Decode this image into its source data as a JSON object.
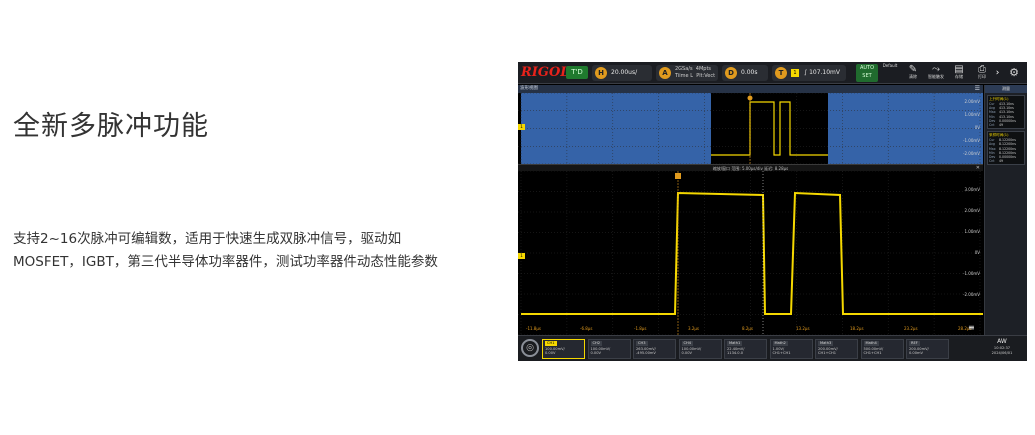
{
  "headline": "全新多脉冲功能",
  "description": "支持2~16次脉冲可编辑数，适用于快速生成双脉冲信号，驱动如MOSFET，IGBT，第三代半导体功率器件，测试功率器件动态性能参数",
  "scope": {
    "brand": "RIGOL",
    "run_state": "T'D",
    "horizontal": {
      "badge": "H",
      "value": "20.00us/",
      "sub1": "",
      "sub2": ""
    },
    "acquire": {
      "badge": "A",
      "line1": "2GSa/s",
      "line2": "Tiime L",
      "right1": "4Mpts",
      "right2": "Plt:Vect"
    },
    "delay": {
      "badge": "D",
      "value": "0.00s"
    },
    "trigger": {
      "badge": "T",
      "source": "1",
      "edge": "∫",
      "value": "107.10mV"
    },
    "tools": [
      {
        "name": "auto",
        "icon": "",
        "label": "AUTO\nSET"
      },
      {
        "name": "default",
        "icon": "",
        "label": "Default"
      },
      {
        "name": "clear",
        "icon": "✎",
        "label": "清除"
      },
      {
        "name": "single",
        "icon": "⤳",
        "label": "智能触发"
      },
      {
        "name": "storage",
        "icon": "▤",
        "label": "存储"
      },
      {
        "name": "quick",
        "icon": "⎙",
        "label": "打印"
      }
    ],
    "overview_title": "波形视图",
    "zoom_title": "缩放/窗口  范围: 5.00μs/div  延迟: 8.28μs",
    "channel_marker": "1",
    "overview_axis": [
      "2.00mV",
      "1.00mV",
      "0V",
      "-1.00mV",
      "-2.00mV"
    ],
    "main_axis": [
      "3.00mV",
      "2.00mV",
      "1.00mV",
      "0V",
      "-1.00mV",
      "-2.00mV"
    ],
    "time_labels": [
      "-11.8μs",
      "-6.8μs",
      "-1.8μs",
      "3.2μs",
      "8.2μs",
      "13.2μs",
      "18.2μs",
      "23.2μs",
      "28.2μs"
    ],
    "waveform_points": [
      [
        0.0,
        0
      ],
      [
        5.0,
        0
      ],
      [
        5.0,
        1
      ],
      [
        10.2,
        1
      ],
      [
        10.2,
        0
      ],
      [
        11.5,
        0
      ],
      [
        11.5,
        1
      ],
      [
        14.5,
        1
      ],
      [
        14.5,
        0
      ],
      [
        20.0,
        0
      ]
    ],
    "panel": {
      "header": "测量",
      "boxes": [
        {
          "title": "上升时间(1)",
          "rows": [
            [
              "Cur",
              "413.10ns"
            ],
            [
              "Avg",
              "413.10ns"
            ],
            [
              "Max",
              "413.10ns"
            ],
            [
              "Min",
              "413.10ns"
            ],
            [
              "Dev",
              "0.00000ns"
            ],
            [
              "Cnt",
              "49"
            ]
          ]
        },
        {
          "title": "采样时间(1)",
          "rows": [
            [
              "Cur",
              "8.12200ns"
            ],
            [
              "Avg",
              "8.12200ns"
            ],
            [
              "Max",
              "8.12200ns"
            ],
            [
              "Min",
              "8.12200ns"
            ],
            [
              "Dev",
              "0.00000ns"
            ],
            [
              "Cnt",
              "49"
            ]
          ]
        }
      ]
    },
    "channels": [
      {
        "tag": "CH1",
        "l1": "100.00mV/",
        "l2": "0.00V",
        "active": true
      },
      {
        "tag": "CH2",
        "l1": "100.00mV/",
        "l2": "0.00V",
        "active": false
      },
      {
        "tag": "CH3",
        "l1": "263.00mV/",
        "l2": "-495.00mV",
        "active": false
      },
      {
        "tag": "CH4",
        "l1": "100.00mV/",
        "l2": "0.00V",
        "active": false
      },
      {
        "tag": "Math1",
        "l1": "22.40mV/",
        "l2": "1134.0.0",
        "active": false
      },
      {
        "tag": "Math2",
        "l1": "1.00V/",
        "l2": "CH1+CH1",
        "active": false
      },
      {
        "tag": "Math3",
        "l1": "200.00mV/",
        "l2": "CH1+CH1",
        "active": false
      },
      {
        "tag": "Math4",
        "l1": "500.00mV/",
        "l2": "CH1+CH1",
        "active": false
      },
      {
        "tag": "REF",
        "l1": "200.00mV/",
        "l2": "0.00mV",
        "active": false
      }
    ],
    "clock": {
      "time": "10:02:37",
      "date": "2024/06/01",
      "mode": "AW"
    }
  },
  "colors": {
    "trace": "#f5d800",
    "overview_shade": "#3563a8",
    "cursor": "#e09a1e"
  }
}
